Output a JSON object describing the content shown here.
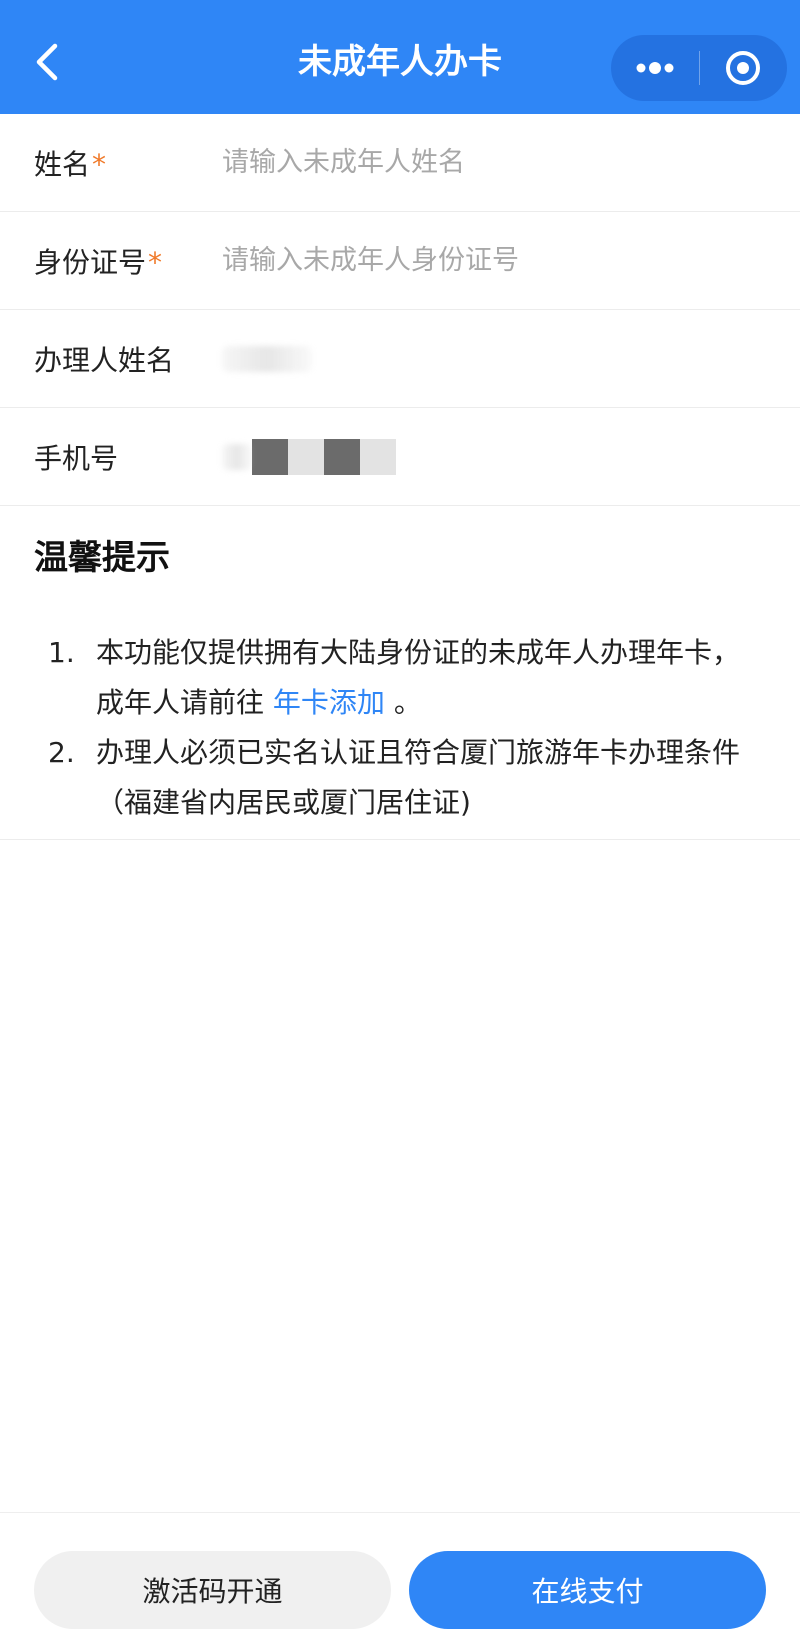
{
  "header": {
    "title": "未成年人办卡",
    "back_icon": "chevron-left-icon",
    "more_icon": "more-dots-icon",
    "close_icon": "target-circle-icon",
    "accent_color": "#2f86f6"
  },
  "form": {
    "name": {
      "label": "姓名",
      "required_mark": "*",
      "placeholder": "请输入未成年人姓名"
    },
    "id_number": {
      "label": "身份证号",
      "required_mark": "*",
      "placeholder": "请输入未成年人身份证号"
    },
    "applicant_name": {
      "label": "办理人姓名"
    },
    "phone": {
      "label": "手机号"
    }
  },
  "tips": {
    "title": "温馨提示",
    "items": [
      {
        "num": "1.",
        "text_before": "本功能仅提供拥有大陆身份证的未成年人办理年卡，成年人请前往 ",
        "link": "年卡添加",
        "text_after": " 。"
      },
      {
        "num": "2.",
        "text": "办理人必须已实名认证且符合厦门旅游年卡办理条件（福建省内居民或厦门居住证)"
      }
    ]
  },
  "actions": {
    "activate_label": "激活码开通",
    "pay_label": "在线支付"
  }
}
